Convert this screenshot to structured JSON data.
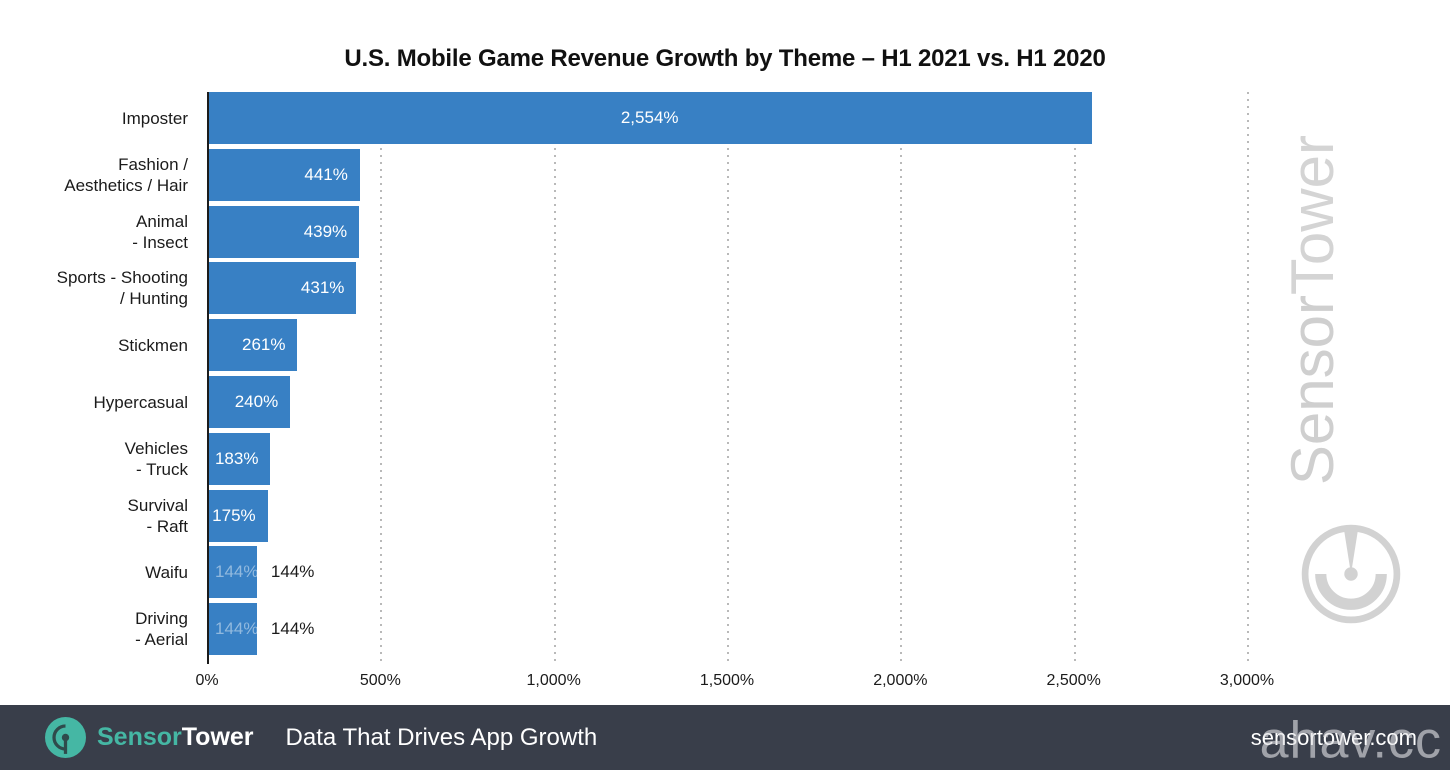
{
  "chart_data": {
    "type": "bar",
    "orientation": "horizontal",
    "title": "U.S. Mobile Game Revenue Growth by Theme – H1 2021 vs. H1 2020",
    "xlabel": "",
    "ylabel": "",
    "xlim": [
      0,
      3000
    ],
    "grid": "vertical-dotted",
    "legend": "none",
    "categories": [
      "Imposter",
      "Fashion /\nAesthetics / Hair",
      "Animal\n- Insect",
      "Sports - Shooting\n/ Hunting",
      "Stickmen",
      "Hypercasual",
      "Vehicles\n- Truck",
      "Survival\n- Raft",
      "Waifu",
      "Driving\n- Aerial"
    ],
    "values": [
      2554,
      441,
      439,
      431,
      261,
      240,
      183,
      175,
      144,
      144
    ],
    "value_labels": [
      "2,554%",
      "441%",
      "439%",
      "431%",
      "261%",
      "240%",
      "183%",
      "175%",
      "144%",
      "144%"
    ],
    "label_placement": [
      "inside-center",
      "inside-end",
      "inside-end",
      "inside-end",
      "inside-end",
      "inside-end",
      "inside-end",
      "inside-end",
      "outside-end",
      "outside-end"
    ],
    "xticks": [
      0,
      500,
      1000,
      1500,
      2000,
      2500,
      3000
    ],
    "xtick_labels": [
      "0%",
      "500%",
      "1,000%",
      "1,500%",
      "2,000%",
      "2,500%",
      "3,000%"
    ],
    "bar_color": "#3880c4",
    "bar_label_inside_color": "#ffffff",
    "bar_label_outside_color": "#1b1b1b",
    "gridline_color": "#b9b9b9",
    "axis_color": "#1b1b1b"
  },
  "watermark": {
    "brand_sensor": "Sensor",
    "brand_tower": "Tower",
    "logo_icon": "sensortower-radar-logo-icon",
    "color": "#d4d4d4"
  },
  "footer": {
    "logo_icon": "sensortower-radar-logo-icon",
    "brand_sensor": "Sensor",
    "brand_tower": "Tower",
    "tagline": "Data That Drives App Growth",
    "url": "sensortower.com",
    "overlay_watermark": "ahav.cc",
    "background": "#393e4a",
    "brand_accent": "#45b7a4"
  }
}
